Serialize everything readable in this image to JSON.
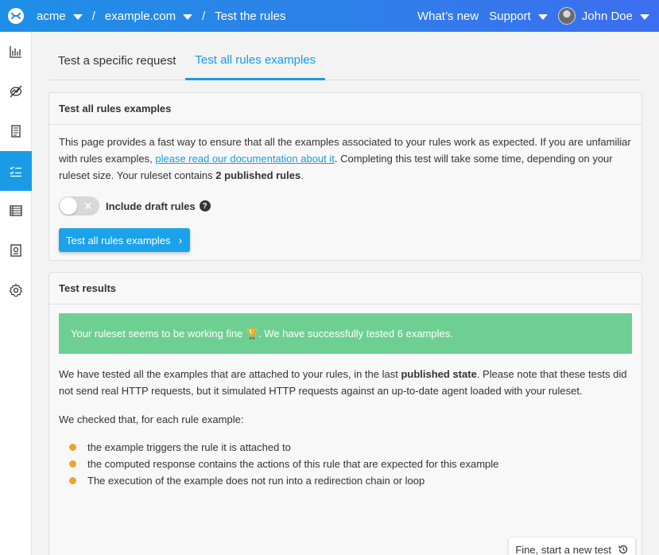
{
  "topbar": {
    "org": "acme",
    "site": "example.com",
    "page": "Test the rules",
    "separator": "/",
    "whats_new": "What’s new",
    "support": "Support",
    "user": "John Doe"
  },
  "sidebar": {
    "items": [
      {
        "icon": "analytics-icon"
      },
      {
        "icon": "monitoring-icon"
      },
      {
        "icon": "document-icon"
      },
      {
        "icon": "checklist-icon",
        "active": true
      },
      {
        "icon": "list-icon"
      },
      {
        "icon": "badge-icon"
      },
      {
        "icon": "gear-icon"
      }
    ]
  },
  "tabs": {
    "specific": "Test a specific request",
    "all": "Test all rules examples"
  },
  "card1": {
    "title": "Test all rules examples",
    "text_a": "This page provides a fast way to ensure that all the examples associated to your rules work as expected. If you are unfamiliar with rules examples, ",
    "link": "please read our documentation about it",
    "text_b": ". Completing this test will take some time, depending on your ruleset size. Your ruleset contains ",
    "count": "2 published rules",
    "text_c": ".",
    "toggle_label": "Include draft rules",
    "help": "?",
    "button": "Test all rules examples",
    "button_chevron": "›"
  },
  "card2": {
    "title": "Test results",
    "alert_a": "Your ruleset seems to be working fine ",
    "alert_trophy": "🏆",
    "alert_b": ". We have successfully tested 6 examples.",
    "p1_a": "We have tested all the examples that are attached to your rules, in the last ",
    "p1_bold": "published state",
    "p1_b": ". Please note that these tests did not send real HTTP requests, but it simulated HTTP requests against an up-to-date agent loaded with your ruleset.",
    "p2": "We checked that, for each rule example:",
    "checks": [
      "the example triggers the rule it is attached to",
      "the computed response contains the actions of this rule that are expected for this example",
      "The execution of the example does not run into a redirection chain or loop"
    ],
    "new_test_button": "Fine, start a new test"
  },
  "colors": {
    "accent": "#1a9be6",
    "success": "#6ecf93",
    "bullet": "#f0a22a"
  }
}
